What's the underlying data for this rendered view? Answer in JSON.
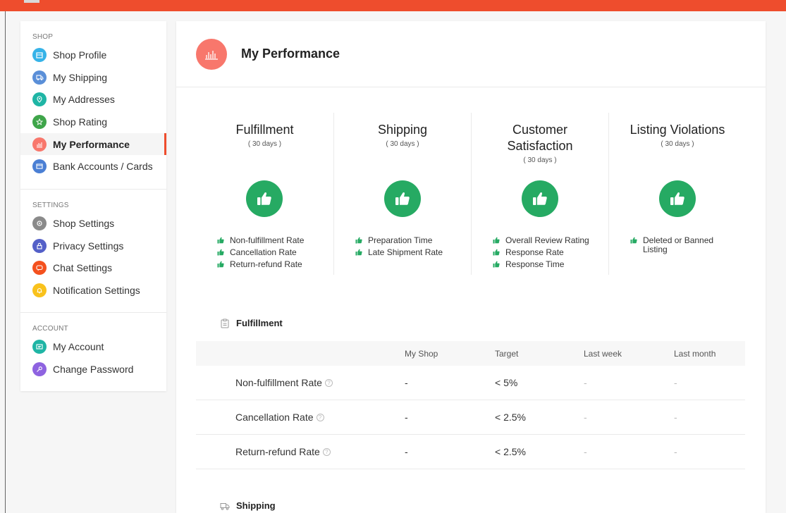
{
  "colors": {
    "brand": "#ee4d2d",
    "success": "#26aa63",
    "performance_icon": "#f8776c"
  },
  "sidebar": {
    "sections": [
      {
        "title": "SHOP",
        "items": [
          {
            "label": "Shop Profile",
            "icon": "store-icon",
            "color": "#36b3e8"
          },
          {
            "label": "My Shipping",
            "icon": "truck-icon",
            "color": "#5a8fd8"
          },
          {
            "label": "My Addresses",
            "icon": "location-icon",
            "color": "#1fb5a5"
          },
          {
            "label": "Shop Rating",
            "icon": "star-icon",
            "color": "#3fa54a"
          },
          {
            "label": "My Performance",
            "icon": "chart-icon",
            "color": "#f8776c",
            "active": true
          },
          {
            "label": "Bank Accounts / Cards",
            "icon": "card-icon",
            "color": "#4a7fd4"
          }
        ]
      },
      {
        "title": "SETTINGS",
        "items": [
          {
            "label": "Shop Settings",
            "icon": "gear-icon",
            "color": "#8a8a8a"
          },
          {
            "label": "Privacy Settings",
            "icon": "lock-icon",
            "color": "#5460c8"
          },
          {
            "label": "Chat Settings",
            "icon": "chat-icon",
            "color": "#f4511e"
          },
          {
            "label": "Notification Settings",
            "icon": "bell-icon",
            "color": "#f9c21c"
          }
        ]
      },
      {
        "title": "ACCOUNT",
        "items": [
          {
            "label": "My Account",
            "icon": "id-card-icon",
            "color": "#1fb5a5"
          },
          {
            "label": "Change Password",
            "icon": "key-icon",
            "color": "#8e63e0"
          }
        ]
      }
    ]
  },
  "header": {
    "title": "My Performance",
    "icon": "chart-icon"
  },
  "metrics": [
    {
      "title": "Fulfillment",
      "period": "( 30 days )",
      "items": [
        "Non-fulfillment Rate",
        "Cancellation Rate",
        "Return-refund Rate"
      ]
    },
    {
      "title": "Shipping",
      "period": "( 30 days )",
      "items": [
        "Preparation Time",
        "Late Shipment Rate"
      ]
    },
    {
      "title": "Customer Satisfaction",
      "period": "( 30 days )",
      "items": [
        "Overall Review Rating",
        "Response Rate",
        "Response Time"
      ]
    },
    {
      "title": "Listing Violations",
      "period": "( 30 days )",
      "items": [
        "Deleted or Banned Listing"
      ]
    }
  ],
  "fulfillment": {
    "title": "Fulfillment",
    "columns": [
      "",
      "My Shop",
      "Target",
      "Last week",
      "Last month"
    ],
    "rows": [
      {
        "metric": "Non-fulfillment Rate",
        "my_shop": "-",
        "target": "< 5%",
        "last_week": "-",
        "last_month": "-"
      },
      {
        "metric": "Cancellation Rate",
        "my_shop": "-",
        "target": "< 2.5%",
        "last_week": "-",
        "last_month": "-"
      },
      {
        "metric": "Return-refund Rate",
        "my_shop": "-",
        "target": "< 2.5%",
        "last_week": "-",
        "last_month": "-"
      }
    ]
  },
  "shipping": {
    "title": "Shipping"
  }
}
